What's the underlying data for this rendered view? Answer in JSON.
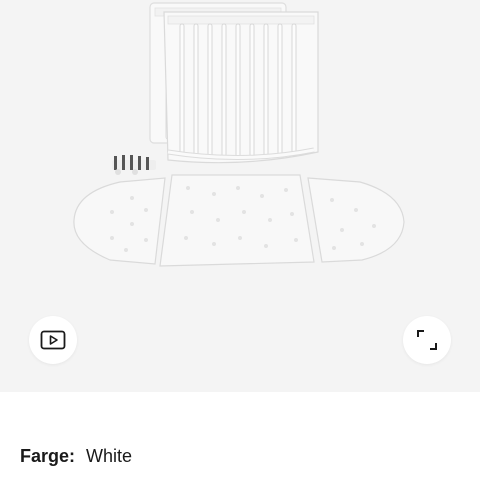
{
  "product": {
    "image_icon": "stroller-bed-parts-image",
    "colors": {
      "background": "#f4f4f4",
      "part_fill": "#f7f7f7",
      "part_stroke": "#dcdcdc"
    }
  },
  "controls": {
    "video_icon": "play-video-icon",
    "fullscreen_icon": "expand-icon"
  },
  "color_selector": {
    "label": "Farge:",
    "value": "White"
  }
}
